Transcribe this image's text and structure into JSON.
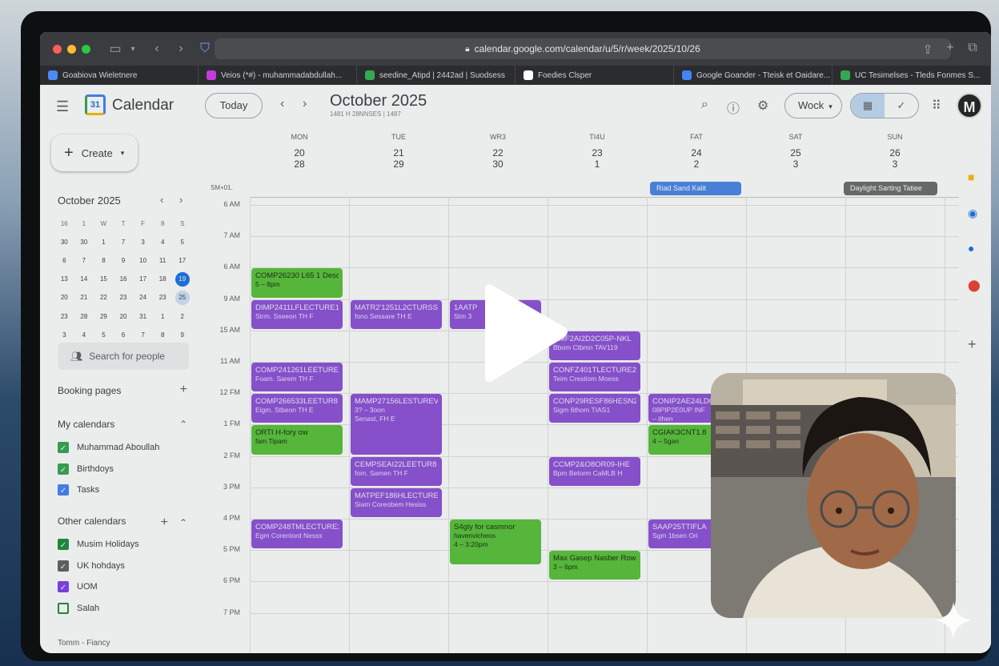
{
  "browser": {
    "url": "calendar.google.com/calendar/u/5/r/week/2025/10/26",
    "tabs": [
      {
        "label": "Goabiova Wieletnere",
        "color": "#4a8af4"
      },
      {
        "label": "Veios (*#) - muhammadabdullah...",
        "color": "#c53bd9"
      },
      {
        "label": "seedine_Atipd | 2442ad | Suodsess",
        "color": "#34a853"
      },
      {
        "label": "Foedies Clsper",
        "color": "#ffffff"
      },
      {
        "label": "Google Goander - Tteisk et Oaidare...",
        "color": "#4285f4"
      },
      {
        "label": "UC Tesimelses - Tleds Fonmes S...",
        "color": "#34a853"
      }
    ]
  },
  "header": {
    "app_title": "Calendar",
    "today_label": "Today",
    "month_title": "October 2025",
    "month_subtitle": "1481 H  28NNSES | 1487",
    "view_label": "Wock",
    "avatar_letter": "M"
  },
  "sidebar": {
    "create_label": "Create",
    "mini_month": "October 2025",
    "mini_headers": [
      "16",
      "1",
      "W",
      "T",
      "F",
      "8",
      "S"
    ],
    "mini_weeks": [
      [
        "30",
        "30",
        "1",
        "7",
        "3",
        "4",
        "5"
      ],
      [
        "6",
        "7",
        "8",
        "9",
        "10",
        "11",
        "17"
      ],
      [
        "13",
        "14",
        "15",
        "16",
        "17",
        "18",
        "19"
      ],
      [
        "20",
        "21",
        "22",
        "23",
        "24",
        "23",
        "25"
      ],
      [
        "23",
        "28",
        "29",
        "20",
        "31",
        "1",
        "2"
      ],
      [
        "3",
        "4",
        "5",
        "6",
        "7",
        "8",
        "9"
      ]
    ],
    "search_placeholder": "Search for people",
    "booking_label": "Booking pages",
    "my_calendars_label": "My calendars",
    "my_calendars": [
      {
        "label": "Muhammad Aboullah",
        "color": "#34a853"
      },
      {
        "label": "Birthdoys",
        "color": "#34a853"
      },
      {
        "label": "Tasks",
        "color": "#4285f4"
      }
    ],
    "other_calendars_label": "Other calendars",
    "other_calendars": [
      {
        "label": "Musim Holidays",
        "color": "#1e8e3e"
      },
      {
        "label": "UK hohdays",
        "color": "#616161"
      },
      {
        "label": "UOM",
        "color": "#7e3ff2"
      },
      {
        "label": "Salah",
        "color": "#ffffff"
      }
    ],
    "footer": "Tomm - Fiancy"
  },
  "days": [
    {
      "name": "MON",
      "num": "20",
      "alt": "28"
    },
    {
      "name": "TUE",
      "num": "21",
      "alt": "29"
    },
    {
      "name": "WR3",
      "num": "22",
      "alt": "30"
    },
    {
      "name": "TI4U",
      "num": "23",
      "alt": "1"
    },
    {
      "name": "FAT",
      "num": "24",
      "alt": "2"
    },
    {
      "name": "SAT",
      "num": "25",
      "alt": "3"
    },
    {
      "name": "SUN",
      "num": "26",
      "alt": "3"
    }
  ],
  "timezone_label": "SM+01.",
  "all_day": [
    {
      "label": "Riad Sand Kalit",
      "color": "#1a73e8"
    },
    {
      "label": "Daylight Sarting Tatiee",
      "color": "#616161"
    }
  ],
  "hours": [
    "6 AM",
    "7 AM",
    "6 AM",
    "9 AM",
    "15 AM",
    "11 AM",
    "12 FM",
    "1 FM",
    "2 FM",
    "3 PM",
    "4 PM",
    "5 PM",
    "6 PM",
    "7 PM"
  ],
  "events": [
    {
      "title": "COMP26230 L65 1 Desc",
      "sub": "5 – 8pm",
      "color": "green"
    },
    {
      "title": "DIMP2411LFLECTURE1",
      "sub": "Strm. Sseeon TH F",
      "color": "purple"
    },
    {
      "title": "MATR2'1251L2CTURSS",
      "sub": "fono Sessare TH E",
      "color": "purple"
    },
    {
      "title": "1AATP",
      "sub": "Stm 3",
      "color": "purple"
    },
    {
      "title": "COMP241261LEETURE3",
      "sub": "Foam. Sarem TH F",
      "color": "purple"
    },
    {
      "title": "COMP266533LEETUR8",
      "sub": "Eigm. Stbeon TH E",
      "color": "purple"
    },
    {
      "title": "ORTI H-fory ow",
      "sub": "fam Tipam",
      "color": "green"
    },
    {
      "title": "MAMP27156LESTUREV",
      "sub": "3? – 3oon",
      "sub2": "Senast, FH E",
      "color": "purple"
    },
    {
      "title": "CEMPSEAI22LEETUR8",
      "sub": "fom. Samen TH F",
      "color": "purple"
    },
    {
      "title": "MATPEF186HLECTURE2",
      "sub": "Siam Coreobem Hesiss",
      "color": "purple"
    },
    {
      "title": "COMP248TMLECTURE2",
      "sub": "Egm Corentord Nesss",
      "color": "purple"
    },
    {
      "title": "S4gly for casmnor",
      "sub": "havenvicheos",
      "sub2": "4 – 3:20pm",
      "color": "green"
    },
    {
      "title": "CMF2AI2D2C05P-NKL",
      "sub": "Bbom Ctbmn TAV119",
      "color": "purple"
    },
    {
      "title": "CONFZ401TLECTURE2",
      "sub": "Teim Crestiom Moess",
      "color": "purple"
    },
    {
      "title": "CONP29RESF86HESN2",
      "sub": "Sigm 6thom TIAS1",
      "color": "purple"
    },
    {
      "title": "CCMP2&O8OR09-IHE",
      "sub": "Bpm Betorm CaMLB H",
      "color": "purple"
    },
    {
      "title": "Max Gasep Nasber Rowk",
      "sub": "3 – 6pm",
      "color": "green"
    },
    {
      "title": "CONIP2AE24LDC",
      "sub": "08PIP2E0UP INF",
      "sub2": "– ithen",
      "color": "purple"
    },
    {
      "title": "CGIAK3CNT1.8",
      "sub": "4 – 5gan",
      "color": "green"
    },
    {
      "title": "SAAP25TTIFLA",
      "sub": "Sgm 1bsen Ori",
      "color": "purple"
    }
  ]
}
